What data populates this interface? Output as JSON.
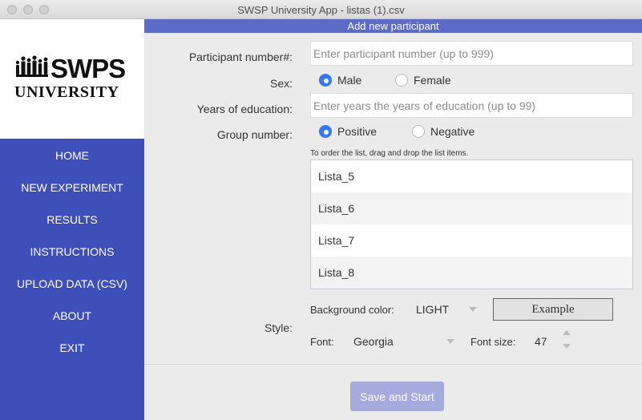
{
  "window": {
    "title": "SWSP University App - listas (1).csv"
  },
  "logo": {
    "line1": "SWPS",
    "line2": "UNIVERSITY"
  },
  "nav": {
    "items": [
      {
        "label": "HOME"
      },
      {
        "label": "NEW EXPERIMENT"
      },
      {
        "label": "RESULTS"
      },
      {
        "label": "INSTRUCTIONS"
      },
      {
        "label": "UPLOAD DATA (CSV)"
      },
      {
        "label": "ABOUT"
      },
      {
        "label": "EXIT"
      }
    ]
  },
  "form": {
    "header": "Add new participant",
    "participant_number": {
      "label": "Participant number#:",
      "value": "",
      "placeholder": "Enter participant number (up to 999)"
    },
    "sex": {
      "label": "Sex:",
      "options": [
        "Male",
        "Female"
      ],
      "selected": "Male"
    },
    "education": {
      "label": "Years of education:",
      "value": "",
      "placeholder": "Enter years the years of education (up to 99)"
    },
    "group": {
      "label": "Group number:",
      "options": [
        "Positive",
        "Negative"
      ],
      "selected": "Positive"
    },
    "list_hint": "To order the list, drag and drop the list items.",
    "list_items": [
      "Lista_5",
      "Lista_6",
      "Lista_7",
      "Lista_8"
    ],
    "style": {
      "label": "Style:",
      "background_label": "Background color:",
      "background_value": "LIGHT",
      "example_text": "Example",
      "font_label": "Font:",
      "font_value": "Georgia",
      "font_size_label": "Font size:",
      "font_size_value": "47"
    },
    "save_label": "Save and Start"
  },
  "colors": {
    "sidebar": "#3f4fba",
    "header": "#5c6bc5",
    "radio_selected": "#3478f6",
    "button": "#a5abdd"
  }
}
